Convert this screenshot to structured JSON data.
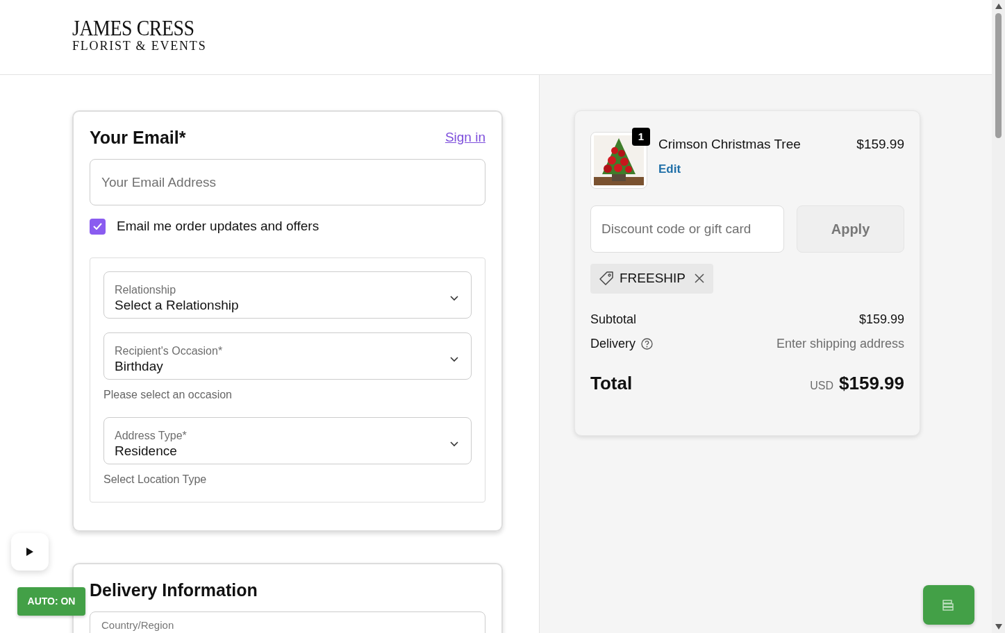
{
  "header": {
    "logo_line_1": "JAMES CRESS",
    "logo_line_2": "FLORIST & EVENTS"
  },
  "email_section": {
    "title": "Your Email*",
    "sign_in_link": "Sign in",
    "email_field": {
      "placeholder": "Your Email Address"
    },
    "opt_in": {
      "label": "Email me order updates and offers",
      "checked": true
    }
  },
  "recipient_fields": [
    {
      "label": "Relationship",
      "value": "Select a Relationship"
    },
    {
      "label": "Recipient's Occasion*",
      "value": "Birthday",
      "hint": "Please select an occasion"
    },
    {
      "label": "Address Type*",
      "value": "Residence",
      "hint": "Select Location Type"
    }
  ],
  "delivery_section": {
    "title": "Delivery Information",
    "first_field_label": "Country/Region"
  },
  "order_summary": {
    "items": [
      {
        "name": "Crimson Christmas Tree",
        "price": "$159.99",
        "quantity": "1",
        "edit_link": "Edit"
      }
    ],
    "discount_field": {
      "placeholder": "Discount code or gift card"
    },
    "apply_button": "Apply",
    "applied_codes": [
      {
        "code": "FREESHIP"
      }
    ],
    "subtotal": {
      "label": "Subtotal",
      "value": "$159.99"
    },
    "delivery": {
      "label": "Delivery",
      "value": "Enter shipping address"
    },
    "total": {
      "label": "Total",
      "currency": "USD",
      "value": "$159.99"
    }
  },
  "auto_toggle": {
    "label": "AUTO: ON"
  }
}
